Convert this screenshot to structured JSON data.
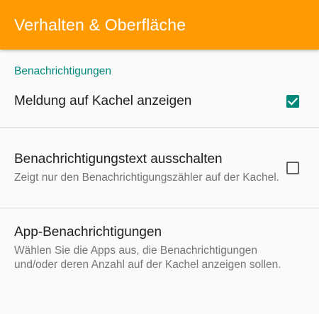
{
  "toolbar": {
    "title": "Verhalten & Oberfläche",
    "color": "#ff9a00"
  },
  "section": {
    "header": "Benachrichtigungen",
    "accent": "#00897b"
  },
  "prefs": [
    {
      "title": "Meldung auf Kachel anzeigen",
      "summary": "",
      "checked": true,
      "icon": "checkbox-checked-icon"
    },
    {
      "title": "Benachrichtigungstext ausschalten",
      "summary": "Zeigt nur den Benachrichtigungszähler auf der Kachel.",
      "checked": false,
      "icon": "checkbox-unchecked-icon"
    },
    {
      "title": "App-Benachrichtigungen",
      "summary": "Wählen Sie die Apps aus, die Benachrichtigungen und/oder deren Anzahl auf der Kachel anzeigen sollen."
    }
  ]
}
